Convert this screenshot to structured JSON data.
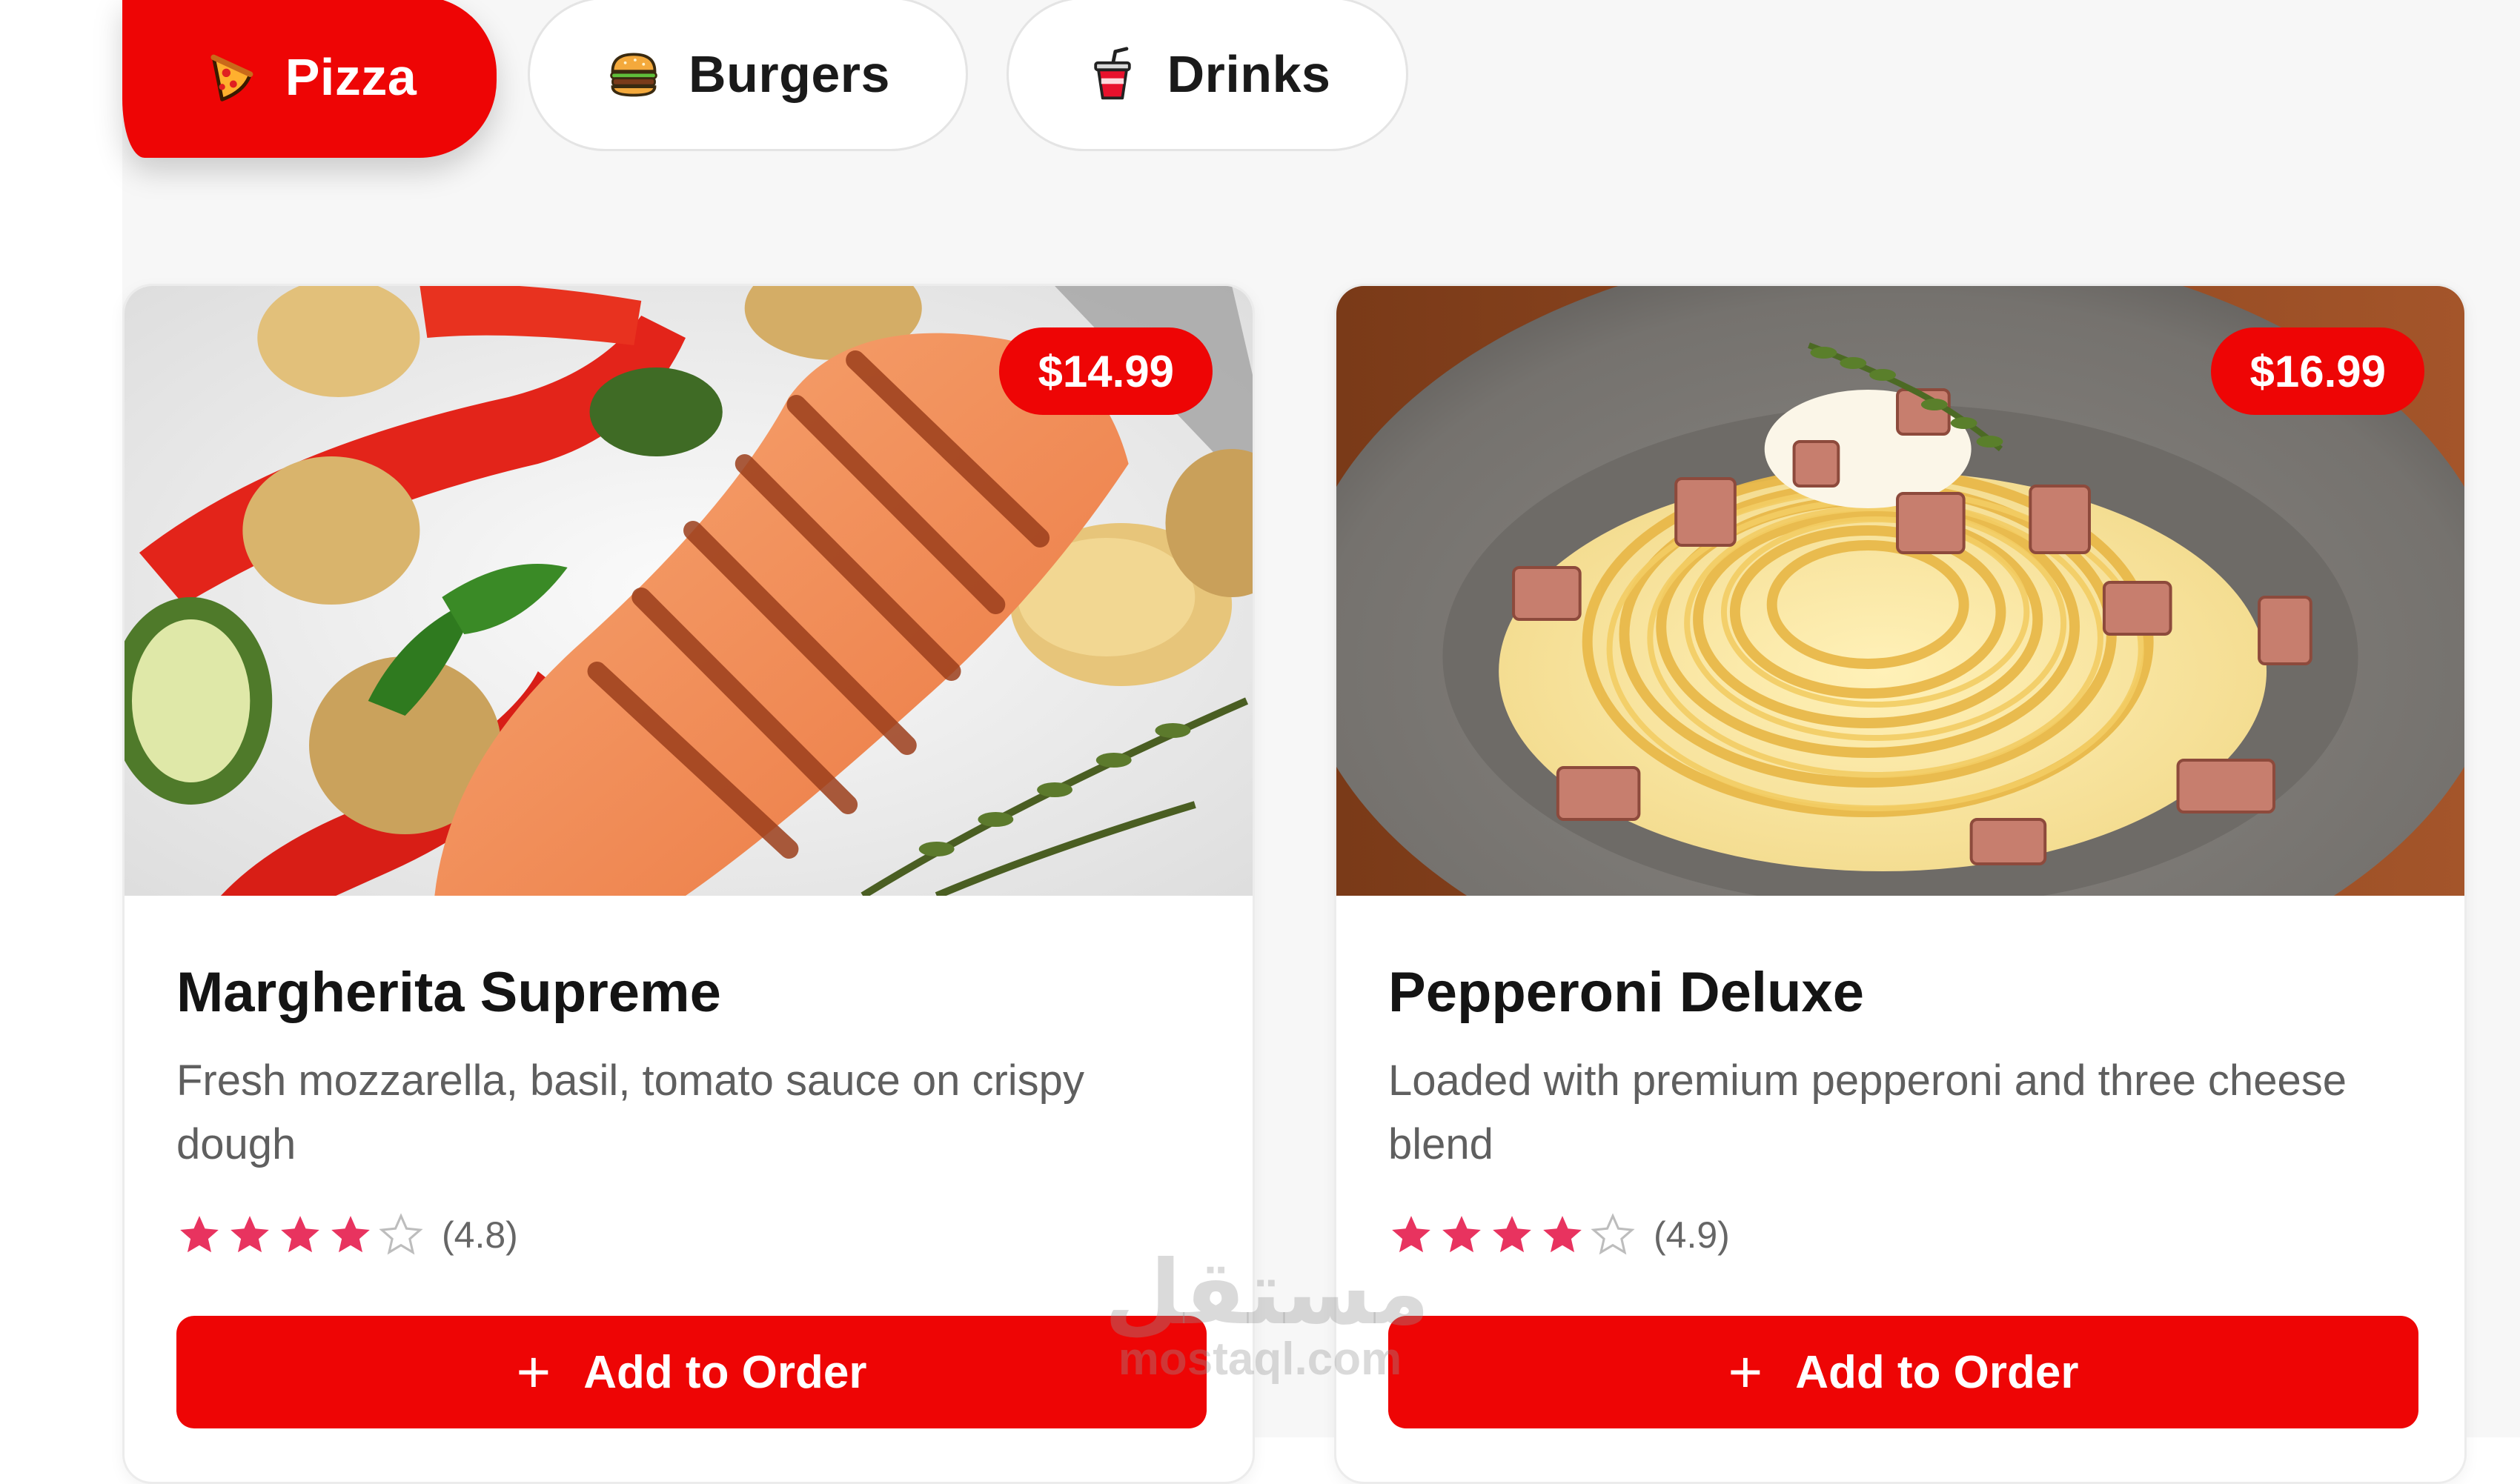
{
  "categories": [
    {
      "label": "Pizza",
      "icon": "pizza-icon",
      "active": true
    },
    {
      "label": "Burgers",
      "icon": "burger-icon",
      "active": false
    },
    {
      "label": "Drinks",
      "icon": "drink-cup-icon",
      "active": false
    }
  ],
  "menu_items": [
    {
      "name": "Margherita Supreme",
      "description": "Fresh mozzarella, basil, tomato sauce on crispy dough",
      "price": "$14.99",
      "stars": 4,
      "rating_text": "(4.8)",
      "button_label": "Add to Order",
      "image": "grilled-salmon-photo"
    },
    {
      "name": "Pepperoni Deluxe",
      "description": "Loaded with premium pepperoni and three cheese blend",
      "price": "$16.99",
      "stars": 4,
      "rating_text": "(4.9)",
      "button_label": "Add to Order",
      "image": "pasta-carbonara-photo"
    }
  ],
  "watermark": {
    "arabic": "مستقل",
    "latin": "mostaql.com"
  },
  "colors": {
    "accent": "#ee0505",
    "star": "#e8335f",
    "background": "#f7f7f7"
  }
}
